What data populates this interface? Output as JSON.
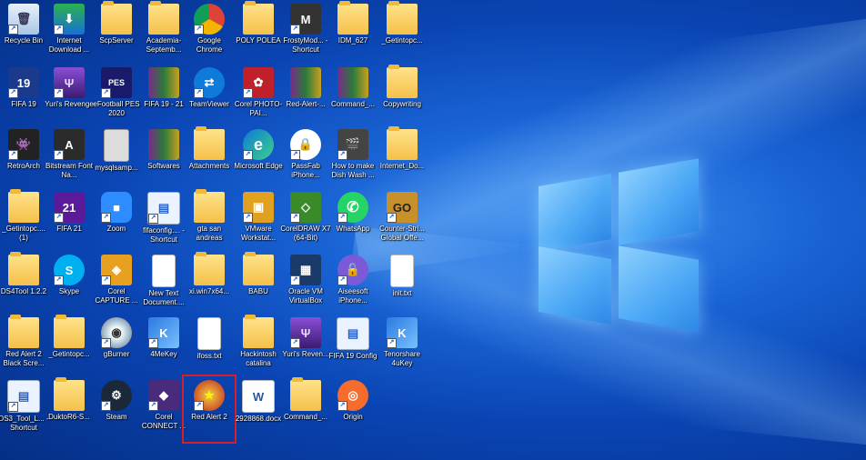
{
  "desktop": {
    "icons": [
      {
        "label": "Recycle Bin",
        "glyph": "🗑",
        "style": "recycle"
      },
      {
        "label": "FIFA 19",
        "glyph": "19",
        "style": "fifa19"
      },
      {
        "label": "RetroArch",
        "glyph": "👾",
        "style": "retro"
      },
      {
        "label": "_Getintopc.... (1)",
        "glyph": "",
        "style": "folder"
      },
      {
        "label": "DS4Tool 1.2.2",
        "glyph": "",
        "style": "folder"
      },
      {
        "label": "Red Alert 2 Black Scre...",
        "glyph": "",
        "style": "folder"
      },
      {
        "label": "DS3_Tool_L... - Shortcut",
        "glyph": "▤",
        "style": "docblue"
      },
      {
        "label": "Internet Download ...",
        "glyph": "⬇",
        "style": "idm"
      },
      {
        "label": "Yuri's Revenge",
        "glyph": "Ψ",
        "style": "yuri"
      },
      {
        "label": "Bitstream Font Na...",
        "glyph": "A",
        "style": "corel"
      },
      {
        "label": "FIFA 21",
        "glyph": "21",
        "style": "fifa21"
      },
      {
        "label": "Skype",
        "glyph": "S",
        "style": "skype"
      },
      {
        "label": "_Getintopc...",
        "glyph": "",
        "style": "folder"
      },
      {
        "label": "DuktoR6-S...",
        "glyph": "",
        "style": "folder"
      },
      {
        "label": "ScpServer",
        "glyph": "",
        "style": "folder"
      },
      {
        "label": "eFootball PES 2020",
        "glyph": "PES",
        "style": "pes"
      },
      {
        "label": "mysqlsamp...",
        "glyph": "",
        "style": "graydoc"
      },
      {
        "label": "Zoom",
        "glyph": "■",
        "style": "zoom"
      },
      {
        "label": "Corel CAPTURE ...",
        "glyph": "◈",
        "style": "corelcap"
      },
      {
        "label": "gBurner",
        "glyph": "◉",
        "style": "gburner"
      },
      {
        "label": "Steam",
        "glyph": "⚙",
        "style": "steam"
      },
      {
        "label": "Academia-Septemb...",
        "glyph": "",
        "style": "folder"
      },
      {
        "label": "FIFA 19 - 21",
        "glyph": "",
        "style": "winrar"
      },
      {
        "label": "Softwares",
        "glyph": "",
        "style": "winrar"
      },
      {
        "label": "fifaconfig.... - Shortcut",
        "glyph": "▤",
        "style": "docblue"
      },
      {
        "label": "New Text Document....",
        "glyph": "",
        "style": "doc"
      },
      {
        "label": "4MeKey",
        "glyph": "K",
        "style": "fourme"
      },
      {
        "label": "Corel CONNECT ...",
        "glyph": "◆",
        "style": "corelconnect"
      },
      {
        "label": "Google Chrome",
        "glyph": "",
        "style": "chrome"
      },
      {
        "label": "TeamViewer",
        "glyph": "⇄",
        "style": "teamviewer"
      },
      {
        "label": "Attachments",
        "glyph": "",
        "style": "folder"
      },
      {
        "label": "gta san andreas",
        "glyph": "",
        "style": "folder"
      },
      {
        "label": "xi.win7x64...",
        "glyph": "",
        "style": "folder"
      },
      {
        "label": "ifoss.txt",
        "glyph": "",
        "style": "doc"
      },
      {
        "label": "Red Alert 2",
        "glyph": "★",
        "style": "redalert"
      },
      {
        "label": "POLY POLEA",
        "glyph": "",
        "style": "folder"
      },
      {
        "label": "Corel PHOTO-PAI...",
        "glyph": "✿",
        "style": "corelphoto"
      },
      {
        "label": "Microsoft Edge",
        "glyph": "e",
        "style": "edge"
      },
      {
        "label": "VMware Workstat...",
        "glyph": "▣",
        "style": "vmware"
      },
      {
        "label": "BABU",
        "glyph": "",
        "style": "folder"
      },
      {
        "label": "Hackintosh catalina",
        "glyph": "",
        "style": "folder"
      },
      {
        "label": "2928868.docx",
        "glyph": "W",
        "style": "word"
      },
      {
        "label": "FrostyMod... - Shortcut",
        "glyph": "M",
        "style": "frosty"
      },
      {
        "label": "Red-Alert-...",
        "glyph": "",
        "style": "winrar"
      },
      {
        "label": "PassFab iPhone...",
        "glyph": "🔒",
        "style": "passfab"
      },
      {
        "label": "CorelDRAW X7 (64-Bit)",
        "glyph": "◇",
        "style": "coreldraw"
      },
      {
        "label": "Oracle VM VirtualBox",
        "glyph": "▦",
        "style": "vbox"
      },
      {
        "label": "Yuri's Reven...",
        "glyph": "Ψ",
        "style": "yuri"
      },
      {
        "label": "Command_...",
        "glyph": "",
        "style": "folder"
      },
      {
        "label": "IDM_627",
        "glyph": "",
        "style": "folder"
      },
      {
        "label": "Command_...",
        "glyph": "",
        "style": "winrar"
      },
      {
        "label": "How to make Dish Wash ...",
        "glyph": "🎬",
        "style": "video"
      },
      {
        "label": "WhatsApp",
        "glyph": "✆",
        "style": "whatsapp"
      },
      {
        "label": "Aiseesoft iPhone...",
        "glyph": "🔓",
        "style": "aisee"
      },
      {
        "label": "FIFA 19 Config",
        "glyph": "▤",
        "style": "docblue"
      },
      {
        "label": "Origin",
        "glyph": "◎",
        "style": "origin"
      },
      {
        "label": "_Getintopc...",
        "glyph": "",
        "style": "folder"
      },
      {
        "label": "Copywriting",
        "glyph": "",
        "style": "folder"
      },
      {
        "label": "Internet_Do...",
        "glyph": "",
        "style": "folder"
      },
      {
        "label": "Counter-Stri... Global Offe...",
        "glyph": "GO",
        "style": "csgo"
      },
      {
        "label": "init.txt",
        "glyph": "",
        "style": "doc"
      },
      {
        "label": "Tenorshare 4uKey",
        "glyph": "K",
        "style": "fourme"
      }
    ]
  },
  "colors": {
    "highlight": "#d4202a"
  }
}
